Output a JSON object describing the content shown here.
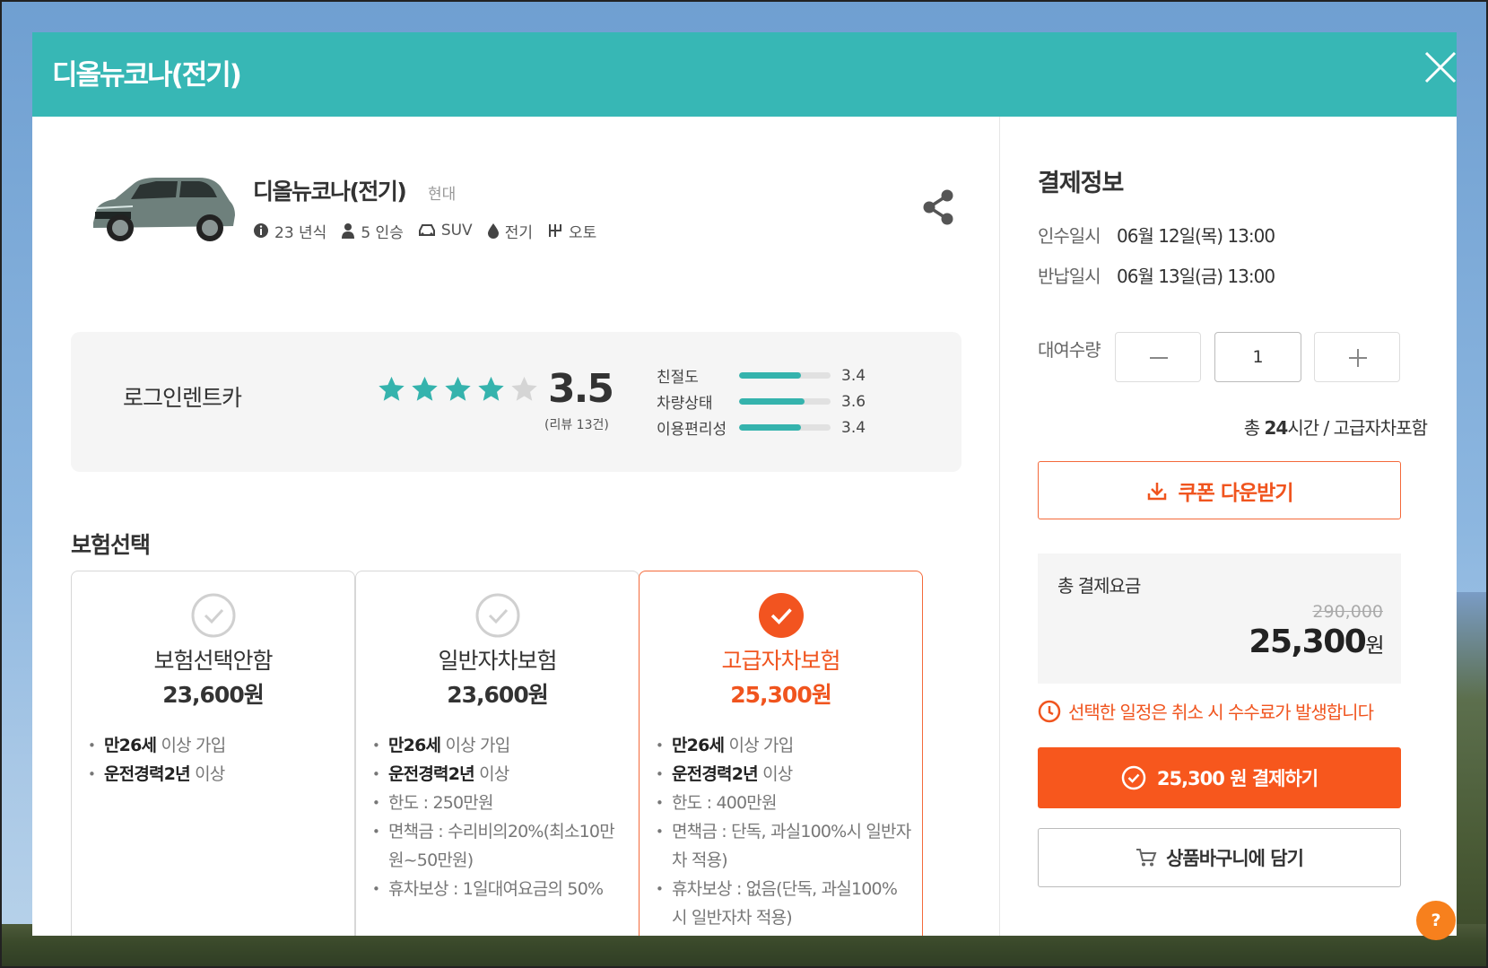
{
  "modal": {
    "title": "디올뉴코나(전기)"
  },
  "car": {
    "image_icon": "car-suv-icon",
    "name": "디올뉴코나(전기)",
    "brand": "현대",
    "specs": [
      {
        "icon": "info-icon",
        "label": "23 년식"
      },
      {
        "icon": "person-icon",
        "label": "5 인승"
      },
      {
        "icon": "car-icon",
        "label": "SUV"
      },
      {
        "icon": "drop-icon",
        "label": "전기"
      },
      {
        "icon": "gear-shift-icon",
        "label": "오토"
      }
    ]
  },
  "rating": {
    "company": "로그인렌트카",
    "stars": 3.5,
    "score": "3.5",
    "review_count": "(리뷰 13건)",
    "details": [
      {
        "label": "친절도",
        "value": "3.4",
        "fraction": 0.68
      },
      {
        "label": "차량상태",
        "value": "3.6",
        "fraction": 0.72
      },
      {
        "label": "이용편리성",
        "value": "3.4",
        "fraction": 0.68
      }
    ]
  },
  "insurance": {
    "section_title": "보험선택",
    "options": [
      {
        "name": "보험선택안함",
        "price": "23,600원",
        "selected": false,
        "items": [
          {
            "bold": "만26세",
            "text": " 이상 가입"
          },
          {
            "bold": "운전경력2년",
            "text": " 이상"
          }
        ]
      },
      {
        "name": "일반자차보험",
        "price": "23,600원",
        "selected": false,
        "items": [
          {
            "bold": "만26세",
            "text": " 이상 가입"
          },
          {
            "bold": "운전경력2년",
            "text": " 이상"
          },
          {
            "bold": "",
            "text": "한도 : 250만원"
          },
          {
            "bold": "",
            "text": "면책금 : 수리비의20%(최소10만원~50만원)"
          },
          {
            "bold": "",
            "text": "휴차보상 : 1일대여요금의 50%"
          }
        ]
      },
      {
        "name": "고급자차보험",
        "price": "25,300원",
        "selected": true,
        "items": [
          {
            "bold": "만26세",
            "text": " 이상 가입"
          },
          {
            "bold": "운전경력2년",
            "text": " 이상"
          },
          {
            "bold": "",
            "text": "한도 : 400만원"
          },
          {
            "bold": "",
            "text": "면책금 : 단독, 과실100%시 일반자차 적용)"
          },
          {
            "bold": "",
            "text": "휴차보상 : 없음(단독, 과실100%시 일반자차 적용)"
          }
        ]
      }
    ]
  },
  "payment": {
    "title": "결제정보",
    "pickup_label": "인수일시",
    "pickup_value": "06월 12일(목) 13:00",
    "return_label": "반납일시",
    "return_value": "06월 13일(금) 13:00",
    "quantity_label": "대여수량",
    "quantity": "1",
    "summary_prefix": "총 ",
    "summary_hours": "24",
    "summary_suffix": "시간 / 고급자차포함",
    "coupon_label": "쿠폰 다운받기",
    "total_label": "총 결제요금",
    "original_price": "290,000",
    "final_price": "25,300",
    "final_unit": "원",
    "cancel_notice": "선택한 일정은 취소 시 수수료가 발생합니다",
    "pay_label": "25,300 원 결제하기",
    "cart_label": "상품바구니에 담기"
  },
  "help": {
    "label": "?"
  },
  "colors": {
    "header": "#37b7b5",
    "accent_orange": "#f7571d",
    "star": "#35b3ad"
  }
}
